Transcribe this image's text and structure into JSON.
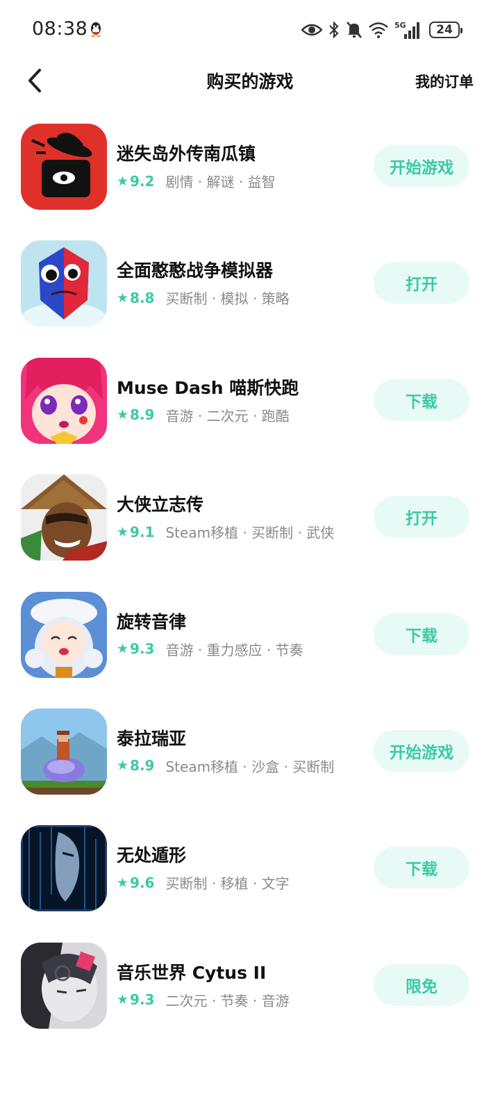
{
  "status_bar": {
    "time": "08:38",
    "network": "5G",
    "battery": "24",
    "icons": [
      "qq-icon",
      "eye-icon",
      "bluetooth-icon",
      "mute-bell-icon",
      "wifi-icon",
      "signal-icon",
      "battery-icon"
    ]
  },
  "header": {
    "title": "购买的游戏",
    "orders_label": "我的订单",
    "back_icon": "chevron-left-icon"
  },
  "accent_color": "#3cc9a6",
  "games": [
    {
      "name": "迷失岛外传南瓜镇",
      "rating": "9.2",
      "tags": "剧情 · 解谜 · 益智",
      "action": "开始游戏"
    },
    {
      "name": "全面憨憨战争模拟器",
      "rating": "8.8",
      "tags": "买断制 · 模拟 · 策略",
      "action": "打开"
    },
    {
      "name": "Muse Dash 喵斯快跑",
      "rating": "8.9",
      "tags": "音游 · 二次元 · 跑酷",
      "action": "下载"
    },
    {
      "name": "大侠立志传",
      "rating": "9.1",
      "tags": "Steam移植 · 买断制 · 武侠",
      "action": "打开"
    },
    {
      "name": "旋转音律",
      "rating": "9.3",
      "tags": "音游 · 重力感应 · 节奏",
      "action": "下载"
    },
    {
      "name": "泰拉瑞亚",
      "rating": "8.9",
      "tags": "Steam移植 · 沙盒 · 买断制",
      "action": "开始游戏"
    },
    {
      "name": "无处遁形",
      "rating": "9.6",
      "tags": "买断制 · 移植 · 文字",
      "action": "下载"
    },
    {
      "name": "音乐世界 Cytus II",
      "rating": "9.3",
      "tags": "二次元 · 节奏 · 音游",
      "action": "限免"
    }
  ]
}
